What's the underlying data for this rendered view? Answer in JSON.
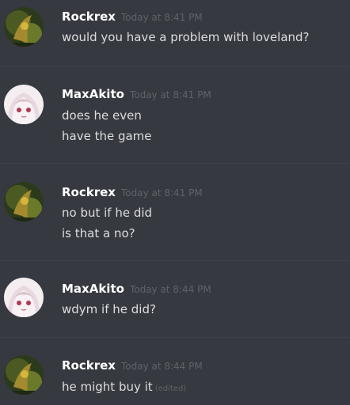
{
  "messages": [
    {
      "author": "Rockrex",
      "timestamp": "Today at 8:41 PM",
      "avatar": "rockrex-avatar",
      "lines": [
        "would you have a problem with loveland?"
      ]
    },
    {
      "author": "MaxAkito",
      "timestamp": "Today at 8:41 PM",
      "avatar": "maxakito-avatar",
      "lines": [
        "does he even",
        "have the game"
      ]
    },
    {
      "author": "Rockrex",
      "timestamp": "Today at 8:41 PM",
      "avatar": "rockrex-avatar",
      "lines": [
        "no but if he did",
        "is that a no?"
      ]
    },
    {
      "author": "MaxAkito",
      "timestamp": "Today at 8:44 PM",
      "avatar": "maxakito-avatar",
      "lines": [
        "wdym if he did?"
      ]
    },
    {
      "author": "Rockrex",
      "timestamp": "Today at 8:44 PM",
      "avatar": "rockrex-avatar",
      "lines": [
        "he might buy it"
      ],
      "edited": "(edited)"
    }
  ],
  "colors": {
    "background": "#36393f",
    "username": "#ffffff",
    "message_text": "#dcddde",
    "timestamp": "#5f6268",
    "divider": "#3f4248"
  }
}
